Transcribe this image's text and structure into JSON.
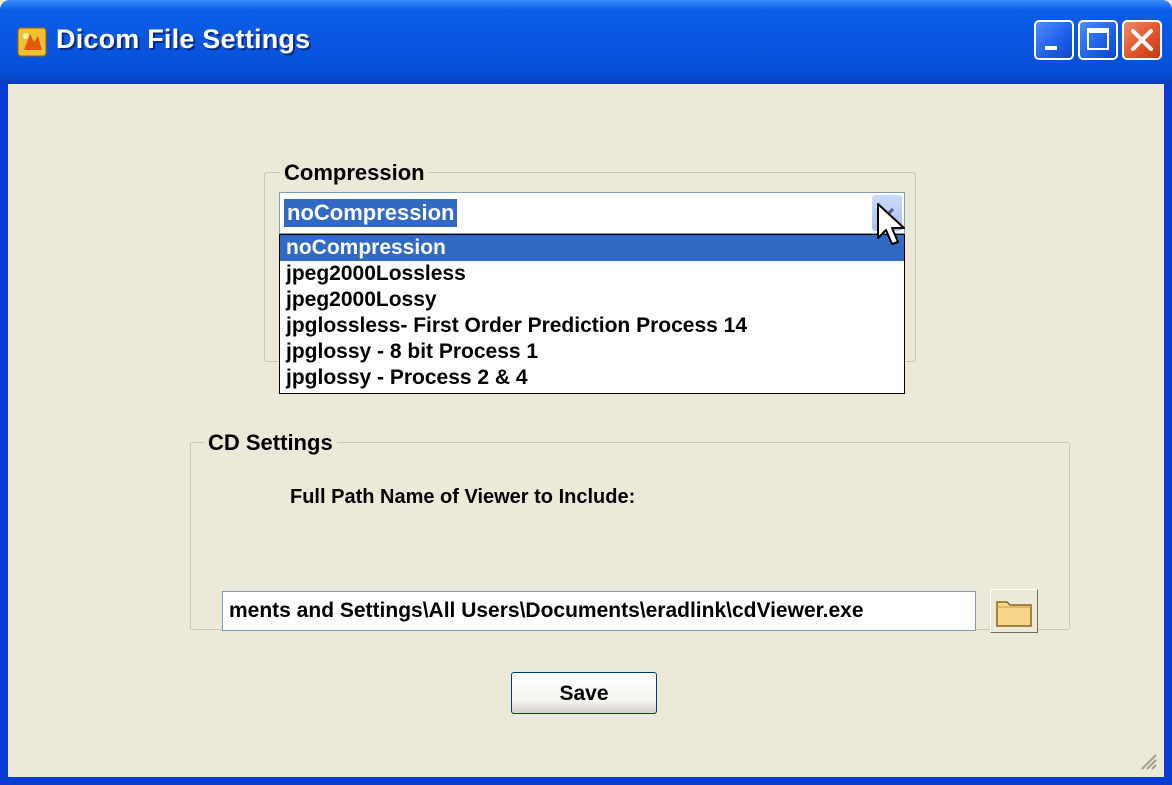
{
  "window": {
    "title": "Dicom File Settings",
    "icons": {
      "app": "app-icon",
      "minimize": "minimize-icon",
      "maximize": "maximize-icon",
      "close": "close-icon"
    }
  },
  "compression": {
    "group_label": "Compression",
    "selected": "noCompression",
    "options": [
      "noCompression",
      "jpeg2000Lossless",
      "jpeg2000Lossy",
      "jpglossless- First Order Prediction Process 14",
      "jpglossy - 8 bit Process 1",
      "jpglossy - Process 2 & 4"
    ]
  },
  "cd_settings": {
    "group_label": "CD Settings",
    "viewer_label": "Full Path Name of Viewer to Include:",
    "viewer_path": "ments and Settings\\All Users\\Documents\\eradlink\\cdViewer.exe",
    "browse_icon": "folder-icon"
  },
  "actions": {
    "save_label": "Save"
  },
  "colors": {
    "titlebar": "#0a56e0",
    "selection": "#316ac5",
    "face": "#ece9d8"
  }
}
